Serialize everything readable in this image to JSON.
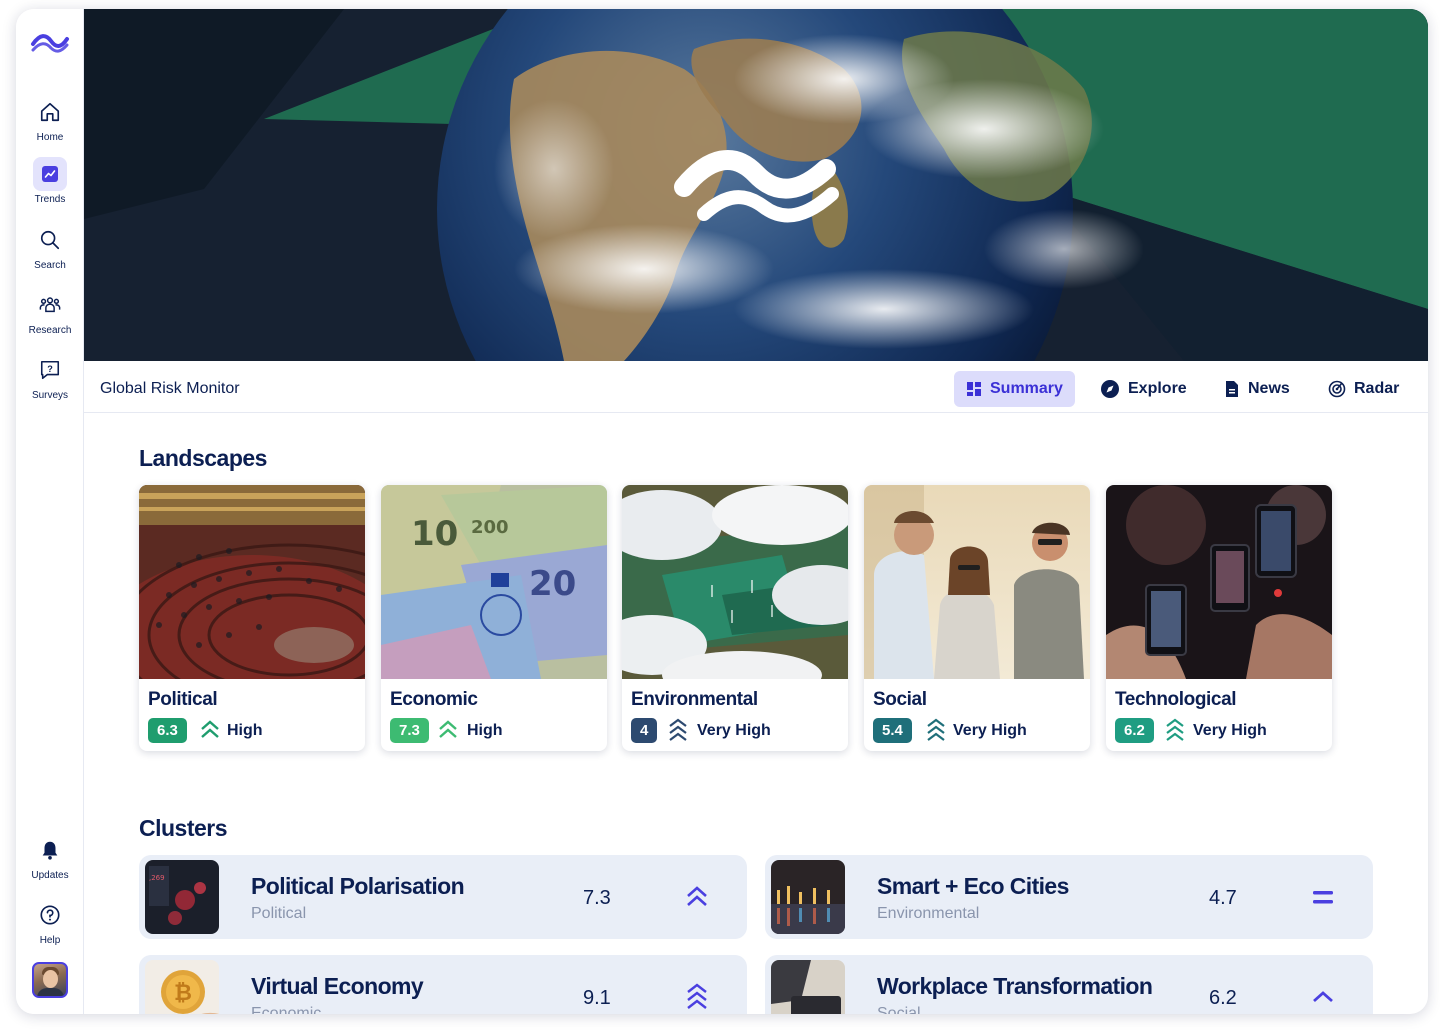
{
  "sidebar": {
    "items": [
      {
        "label": "Home",
        "icon": "home-icon"
      },
      {
        "label": "Trends",
        "icon": "trend-chart-icon",
        "active": true
      },
      {
        "label": "Search",
        "icon": "search-icon"
      },
      {
        "label": "Research",
        "icon": "people-icon"
      },
      {
        "label": "Surveys",
        "icon": "question-chat-icon"
      }
    ],
    "bottom": [
      {
        "label": "Updates",
        "icon": "bell-icon"
      },
      {
        "label": "Help",
        "icon": "help-circle-icon"
      }
    ]
  },
  "header": {
    "title": "Global Risk Monitor",
    "tabs": [
      {
        "label": "Summary",
        "icon": "dashboard-icon",
        "active": true
      },
      {
        "label": "Explore",
        "icon": "compass-icon"
      },
      {
        "label": "News",
        "icon": "document-icon"
      },
      {
        "label": "Radar",
        "icon": "radar-icon"
      }
    ]
  },
  "landscapes": {
    "title": "Landscapes",
    "cards": [
      {
        "name": "Political",
        "score": "6.3",
        "level": "High",
        "score_color": "#1f9d6e",
        "arrow": "double-chevron-up"
      },
      {
        "name": "Economic",
        "score": "7.3",
        "level": "High",
        "score_color": "#3dbb72",
        "arrow": "double-chevron-up"
      },
      {
        "name": "Environmental",
        "score": "4",
        "level": "Very High",
        "score_color": "#2d4a70",
        "arrow": "triple-chevron-up"
      },
      {
        "name": "Social",
        "score": "5.4",
        "level": "Very High",
        "score_color": "#1f6f7a",
        "arrow": "triple-chevron-up"
      },
      {
        "name": "Technological",
        "score": "6.2",
        "level": "Very High",
        "score_color": "#1f9d82",
        "arrow": "triple-chevron-up"
      }
    ]
  },
  "clusters": {
    "title": "Clusters",
    "items": [
      {
        "name": "Political Polarisation",
        "category": "Political",
        "value": "7.3",
        "trend": "double-chevron-up"
      },
      {
        "name": "Smart + Eco Cities",
        "category": "Environmental",
        "value": "4.7",
        "trend": "equals"
      },
      {
        "name": "Virtual Economy",
        "category": "Economic",
        "value": "9.1",
        "trend": "triple-chevron-up"
      },
      {
        "name": "Workplace Transformation",
        "category": "Social",
        "value": "6.2",
        "trend": "chevron-up"
      }
    ]
  },
  "colors": {
    "brand": "#4a3fe0",
    "navy": "#0c1f52",
    "active_tab_bg": "#dcdcfb",
    "cluster_bg": "#e9eef7"
  }
}
